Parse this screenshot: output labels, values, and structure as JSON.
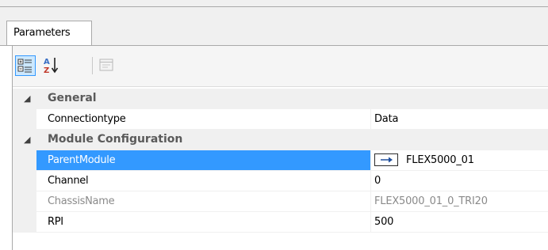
{
  "tab": {
    "label": "Parameters"
  },
  "toolbar": {
    "buttons": [
      {
        "name": "categorized",
        "icon": "categorized-view-icon",
        "active": true
      },
      {
        "name": "alphabetical",
        "icon": "sort-az-icon",
        "active": false
      },
      {
        "name": "property-pages",
        "icon": "property-pages-icon",
        "active": false,
        "disabled": true
      }
    ]
  },
  "grid": {
    "categories": [
      {
        "label": "General",
        "expanded": true,
        "properties": [
          {
            "name": "Connectiontype",
            "value": "Data"
          }
        ]
      },
      {
        "label": "Module Configuration",
        "expanded": true,
        "properties": [
          {
            "name": "ParentModule",
            "value": "FLEX5000_01",
            "selected": true,
            "has_link_button": true
          },
          {
            "name": "Channel",
            "value": "0"
          },
          {
            "name": "ChassisName",
            "value": "FLEX5000_01_0_TRI20",
            "readonly": true
          },
          {
            "name": "RPI",
            "value": "500"
          }
        ]
      }
    ]
  },
  "colors": {
    "selection": "#3399ff",
    "category_bg": "#f0f0f0",
    "readonly_text": "#8a8a8a"
  }
}
